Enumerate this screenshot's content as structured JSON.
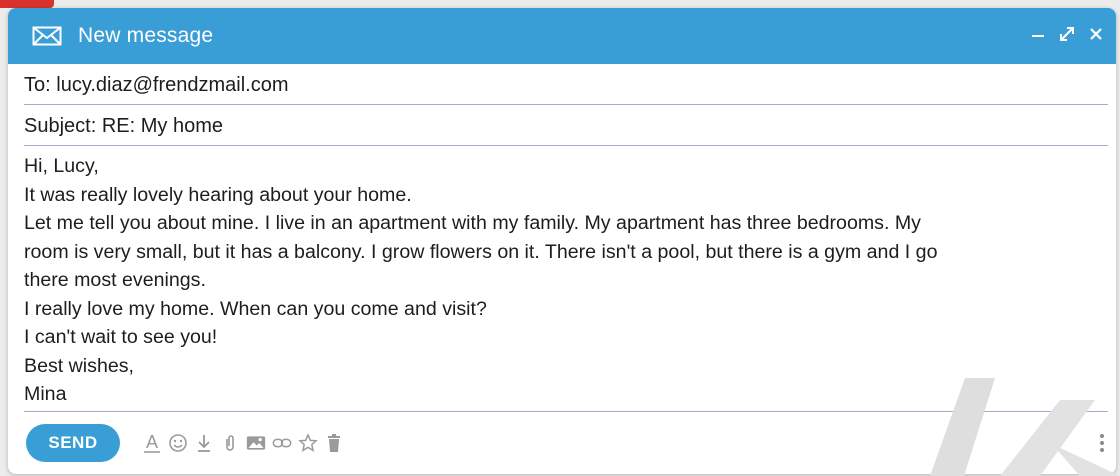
{
  "window": {
    "title": "New message"
  },
  "header": {
    "to_prefix": "To: ",
    "to_value": "lucy.diaz@frendzmail.com",
    "subject_prefix": "Subject: ",
    "subject_value": "RE: My home"
  },
  "body_lines": [
    "Hi, Lucy,",
    "It was really lovely hearing about your home.",
    "Let me tell you about mine. I live in an apartment with my family. My apartment has three bedrooms. My",
    "room is very small, but it has a balcony. I grow flowers on it. There isn't a pool, but there is a gym and I go",
    "there most evenings.",
    "I really love my home. When can you come and visit?",
    "I can't wait to see you!",
    "Best wishes,",
    "Mina"
  ],
  "toolbar": {
    "send_label": "SEND",
    "format_label": "A",
    "tools": [
      "text-format-icon",
      "emoji-icon",
      "download-icon",
      "attachment-icon",
      "image-icon",
      "link-icon",
      "star-icon",
      "trash-icon"
    ]
  },
  "colors": {
    "accent": "#3a9ed6",
    "divider": "#a9a6cf",
    "icon": "#9a9a9a"
  }
}
